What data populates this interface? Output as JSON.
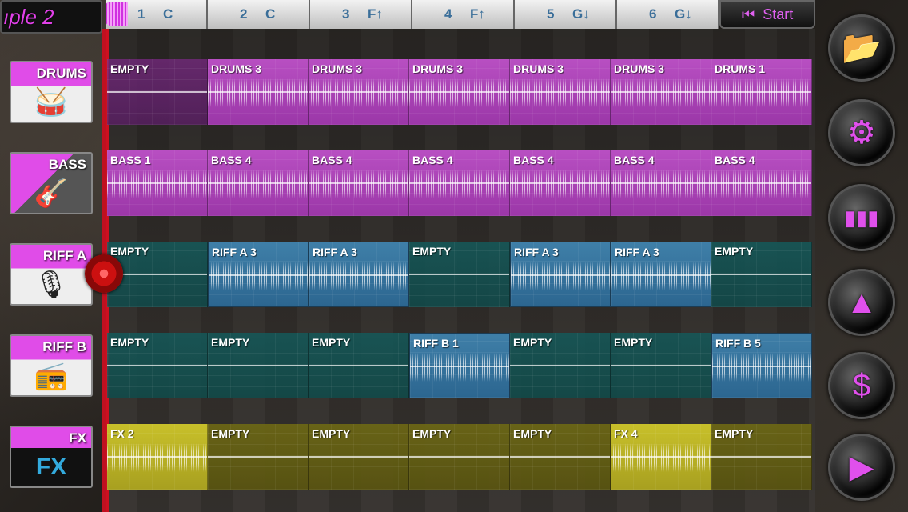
{
  "song_title": "ıple 2",
  "timeline": {
    "bars": [
      {
        "num": "1",
        "chord": "C"
      },
      {
        "num": "2",
        "chord": "C"
      },
      {
        "num": "3",
        "chord": "F↑"
      },
      {
        "num": "4",
        "chord": "F↑"
      },
      {
        "num": "5",
        "chord": "G↓"
      },
      {
        "num": "6",
        "chord": "G↓"
      }
    ],
    "start_label": "Start"
  },
  "tracks": [
    {
      "name": "DRUMS",
      "icon": "drum-kit-icon",
      "glyph": "🥁",
      "color": "magenta",
      "clips": [
        {
          "label": "EMPTY",
          "filled": false
        },
        {
          "label": "DRUMS 3",
          "filled": true
        },
        {
          "label": "DRUMS 3",
          "filled": true
        },
        {
          "label": "DRUMS 3",
          "filled": true
        },
        {
          "label": "DRUMS 3",
          "filled": true
        },
        {
          "label": "DRUMS 3",
          "filled": true
        },
        {
          "label": "DRUMS 1",
          "filled": true
        }
      ]
    },
    {
      "name": "BASS",
      "icon": "bass-guitar-icon",
      "glyph": "🎸",
      "color": "magenta",
      "clips": [
        {
          "label": "BASS 1",
          "filled": true
        },
        {
          "label": "BASS 4",
          "filled": true
        },
        {
          "label": "BASS 4",
          "filled": true
        },
        {
          "label": "BASS 4",
          "filled": true
        },
        {
          "label": "BASS 4",
          "filled": true
        },
        {
          "label": "BASS 4",
          "filled": true
        },
        {
          "label": "BASS 4",
          "filled": true
        }
      ]
    },
    {
      "name": "RIFF A",
      "icon": "amplifier-icon",
      "glyph": "🎙",
      "color": "teal",
      "clips": [
        {
          "label": "EMPTY",
          "filled": false
        },
        {
          "label": "RIFF A 3",
          "filled": true
        },
        {
          "label": "RIFF A 3",
          "filled": true
        },
        {
          "label": "EMPTY",
          "filled": false
        },
        {
          "label": "RIFF A 3",
          "filled": true
        },
        {
          "label": "RIFF A 3",
          "filled": true
        },
        {
          "label": "EMPTY",
          "filled": false
        }
      ]
    },
    {
      "name": "RIFF B",
      "icon": "boombox-icon",
      "glyph": "📻",
      "color": "teal",
      "clips": [
        {
          "label": "EMPTY",
          "filled": false
        },
        {
          "label": "EMPTY",
          "filled": false
        },
        {
          "label": "EMPTY",
          "filled": false
        },
        {
          "label": "RIFF B 1",
          "filled": true
        },
        {
          "label": "EMPTY",
          "filled": false
        },
        {
          "label": "EMPTY",
          "filled": false
        },
        {
          "label": "RIFF B 5",
          "filled": true
        }
      ]
    },
    {
      "name": "FX",
      "icon": "fx-icon",
      "glyph": "FX",
      "color": "olive",
      "clips": [
        {
          "label": "FX 2",
          "filled": true
        },
        {
          "label": "EMPTY",
          "filled": false
        },
        {
          "label": "EMPTY",
          "filled": false
        },
        {
          "label": "EMPTY",
          "filled": false
        },
        {
          "label": "EMPTY",
          "filled": false
        },
        {
          "label": "FX 4",
          "filled": true
        },
        {
          "label": "EMPTY",
          "filled": false
        }
      ]
    }
  ],
  "side_buttons": [
    {
      "name": "open-folder-button",
      "icon": "folder-icon",
      "glyph": "📂"
    },
    {
      "name": "settings-button",
      "icon": "gear-icon",
      "glyph": "⚙"
    },
    {
      "name": "mixer-button",
      "icon": "equalizer-icon",
      "glyph": "▮▮▮"
    },
    {
      "name": "metronome-button",
      "icon": "metronome-icon",
      "glyph": "▲"
    },
    {
      "name": "store-button",
      "icon": "dollar-icon",
      "glyph": "$"
    },
    {
      "name": "play-button",
      "icon": "play-icon",
      "glyph": "▶"
    }
  ],
  "colors": {
    "accent": "#e040e8",
    "drums_bass_clip": "#b84fc2",
    "riff_clip": "#3f7fa8",
    "fx_clip": "#c8c02a",
    "playhead": "#cc1020"
  }
}
